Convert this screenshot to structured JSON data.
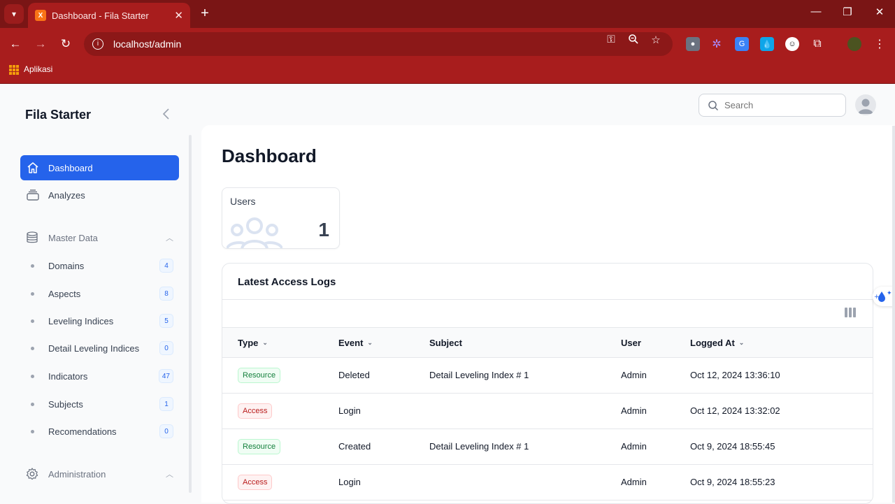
{
  "browser": {
    "tab_title": "Dashboard - Fila Starter",
    "url": "localhost/admin",
    "bookmark_apps": "Aplikasi"
  },
  "colors": {
    "chrome": "#a81d1d",
    "tabbar": "#7a1515",
    "primary": "#2563eb"
  },
  "app": {
    "brand": "Fila Starter",
    "search_placeholder": "Search"
  },
  "sidebar": {
    "items": [
      {
        "label": "Dashboard",
        "icon": "home-icon",
        "active": true
      },
      {
        "label": "Analyzes",
        "icon": "stack-icon",
        "active": false
      }
    ],
    "group_master": {
      "label": "Master Data",
      "icon": "database-icon"
    },
    "master_items": [
      {
        "label": "Domains",
        "count": "4"
      },
      {
        "label": "Aspects",
        "count": "8"
      },
      {
        "label": "Leveling Indices",
        "count": "5"
      },
      {
        "label": "Detail Leveling Indices",
        "count": "0"
      },
      {
        "label": "Indicators",
        "count": "47"
      },
      {
        "label": "Subjects",
        "count": "1"
      },
      {
        "label": "Recomendations",
        "count": "0"
      }
    ],
    "group_admin": {
      "label": "Administration",
      "icon": "gear-icon"
    }
  },
  "main": {
    "title": "Dashboard",
    "stat": {
      "label": "Users",
      "value": "1"
    },
    "table": {
      "title": "Latest Access Logs",
      "headers": [
        "Type",
        "Event",
        "Subject",
        "User",
        "Logged At"
      ],
      "rows": [
        {
          "type": "Resource",
          "event": "Deleted",
          "subject": "Detail Leveling Index # 1",
          "user": "Admin",
          "logged_at": "Oct 12, 2024 13:36:10"
        },
        {
          "type": "Access",
          "event": "Login",
          "subject": "",
          "user": "Admin",
          "logged_at": "Oct 12, 2024 13:32:02"
        },
        {
          "type": "Resource",
          "event": "Created",
          "subject": "Detail Leveling Index # 1",
          "user": "Admin",
          "logged_at": "Oct 9, 2024 18:55:45"
        },
        {
          "type": "Access",
          "event": "Login",
          "subject": "",
          "user": "Admin",
          "logged_at": "Oct 9, 2024 18:55:23"
        }
      ]
    }
  }
}
